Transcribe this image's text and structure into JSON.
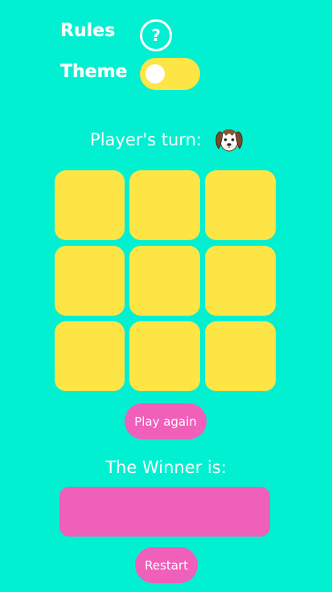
{
  "settings": {
    "rules_label": "Rules",
    "help_glyph": "?",
    "theme_label": "Theme",
    "theme_toggle_on": false
  },
  "turn": {
    "label": "Player's turn:",
    "player_icon": "dog-face-icon"
  },
  "board": {
    "cells": [
      "",
      "",
      "",
      "",
      "",
      "",
      "",
      "",
      ""
    ]
  },
  "buttons": {
    "play_again": "Play again",
    "restart": "Restart"
  },
  "winner": {
    "label": "The Winner is:",
    "value": ""
  },
  "colors": {
    "background": "#00F0D1",
    "cell": "#FDE545",
    "toggle": "#FDE545",
    "accent_pink": "#F05FB9",
    "text": "#FFFFFF"
  }
}
